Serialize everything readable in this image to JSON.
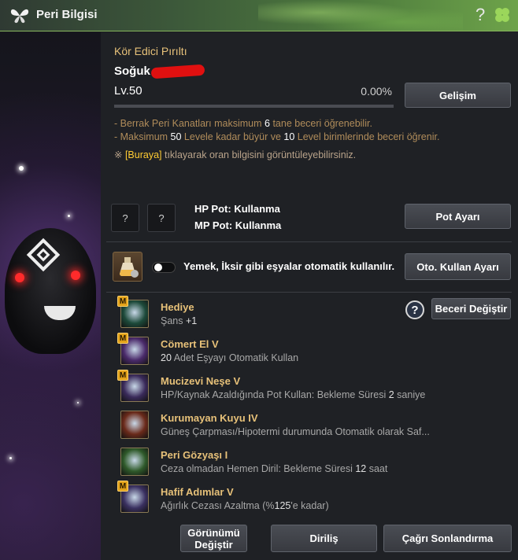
{
  "window": {
    "title": "Peri Bilgisi",
    "help_label": "?"
  },
  "fairy": {
    "name": "Kör Edici Pırıltı",
    "owner_prefix": "Soğuk",
    "level_prefix": "Lv.",
    "level": "50",
    "progress_text": "0.00%",
    "progress": 0.0,
    "develop_button": "Gelişim"
  },
  "info": {
    "line1_pre": "- Berrak Peri Kanatları maksimum ",
    "line1_num": "6",
    "line1_post": " tane beceri öğrenebilir.",
    "line2_pre": "- Maksimum ",
    "line2_num1": "50",
    "line2_mid": " Levele kadar büyür ve ",
    "line2_num2": "10",
    "line2_post": " Level birimlerinde beceri öğrenir.",
    "line3_mark": "※ ",
    "line3_link": "[Buraya]",
    "line3_post": " tıklayarak oran bilgisini görüntüleyebilirsiniz."
  },
  "potions": {
    "slot1": "?",
    "slot2": "?",
    "hp": "HP Pot: Kullanma",
    "mp": "MP Pot: Kullanma",
    "button": "Pot Ayarı"
  },
  "auto_use": {
    "text": "Yemek, İksir gibi eşyalar otomatik kullanılır.",
    "enabled": false,
    "button": "Oto. Kullan Ayarı"
  },
  "skills_header": {
    "help": "?",
    "change_button": "Beceri Değiştir"
  },
  "skills": [
    {
      "badge": "M",
      "name": "Hediye",
      "desc_pre": "Şans ",
      "desc_num": "+1",
      "desc_post": "",
      "icon": "clover-icon",
      "color": "#1d4a3a"
    },
    {
      "badge": "M",
      "name": "Cömert El V",
      "desc_pre": "",
      "desc_num": "20",
      "desc_post": " Adet Eşyayı Otomatik Kullan",
      "icon": "fairy-icon",
      "color": "#4a2a6a"
    },
    {
      "badge": "M",
      "name": "Mucizevi Neşe V",
      "desc_pre": "HP/Kaynak Azaldığında Pot Kullan: Bekleme Süresi ",
      "desc_num": "2",
      "desc_post": " saniye",
      "icon": "potion-plus-icon",
      "color": "#3a2a5a"
    },
    {
      "badge": "",
      "name": "Kurumayan Kuyu IV",
      "desc_pre": "Güneş Çarpması/Hipotermi durumunda Otomatik olarak Saf...",
      "desc_num": "",
      "desc_post": "",
      "icon": "bowl-icon",
      "color": "#6a2a1a"
    },
    {
      "badge": "",
      "name": "Peri Gözyaşı I",
      "desc_pre": "Ceza olmadan Hemen Diril: Bekleme Süresi ",
      "desc_num": "12",
      "desc_post": " saat",
      "icon": "tear-icon",
      "color": "#2f5a2a"
    },
    {
      "badge": "M",
      "name": "Hafif Adımlar V",
      "desc_pre": "Ağırlık Cezası Azaltma (%",
      "desc_num": "125",
      "desc_post": "'e kadar)",
      "icon": "boots-icon",
      "color": "#3a3060"
    }
  ],
  "footer": {
    "appearance_button": "Görünümü Değiştir",
    "revive_button": "Diriliş",
    "end_summon_button": "Çağrı Sonlandırma"
  }
}
